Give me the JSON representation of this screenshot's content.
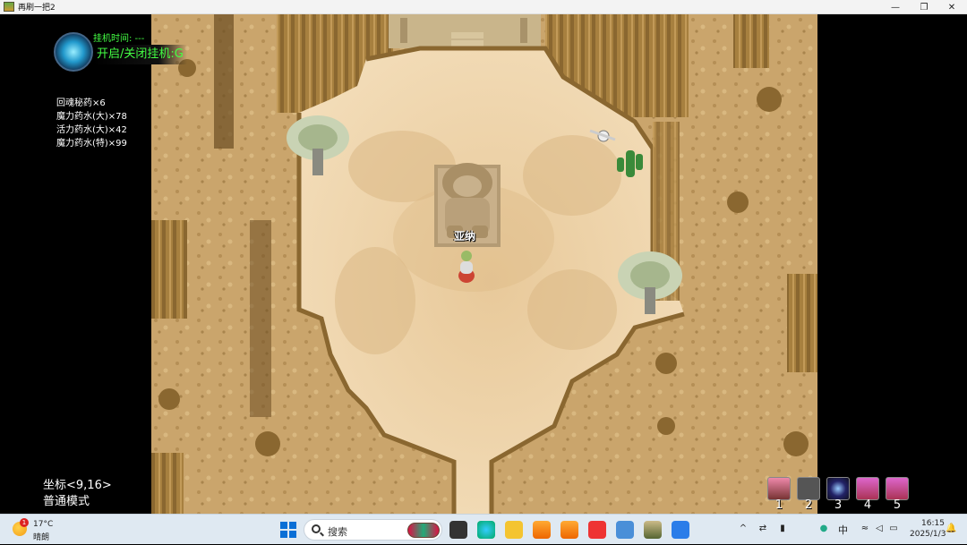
{
  "window": {
    "title": "再刷一把2",
    "controls": [
      "minimize-icon",
      "restore-icon",
      "close-icon"
    ]
  },
  "hud": {
    "afk_time_label": "挂机时间: ---",
    "afk_toggle_label": "开启/关闭挂机:G",
    "potions": [
      "回魂秘药×6",
      "魔力药水(大)×78",
      "活力药水(大)×42",
      "魔力药水(特)×99"
    ],
    "coords_label": "坐标<9,16>",
    "mode_label": "普通模式",
    "skills": [
      {
        "key": "1",
        "icon": "warrior-portrait-icon"
      },
      {
        "key": "2",
        "icon": "empty-slot-icon"
      },
      {
        "key": "3",
        "icon": "blue-orb-icon"
      },
      {
        "key": "4",
        "icon": "pink-spirit-icon"
      },
      {
        "key": "5",
        "icon": "pink-spirit-icon"
      }
    ]
  },
  "scene": {
    "npc_name": "亚纳",
    "statue": "lion-statue",
    "objects": [
      "baobab-tree",
      "baobab-tree",
      "cactus",
      "skull-bones",
      "temple-stairs"
    ]
  },
  "taskbar": {
    "weather": {
      "temp": "17°C",
      "desc": "晴朗",
      "badge": "1"
    },
    "search_placeholder": "搜索",
    "ime": "中",
    "time": "16:15",
    "date": "2025/1/3",
    "tray_icons": [
      "chevron-up-icon",
      "arrows-icon",
      "media-icon",
      "wifi-icon",
      "speaker-icon",
      "battery-icon",
      "bell-icon"
    ],
    "apps": [
      "windows-start-icon",
      "file-explorer-icon",
      "edge-icon",
      "folder-icon",
      "flame-app-icon",
      "flame-app-icon",
      "wps-icon",
      "store-icon",
      "game-icon",
      "phone-link-icon"
    ]
  },
  "colors": {
    "sand": "#f0d9b2",
    "cliff": "#c9a468",
    "cliff_dark": "#7a5a2a",
    "afk_green": "#44ff44",
    "taskbar": "#dfe9f2"
  }
}
